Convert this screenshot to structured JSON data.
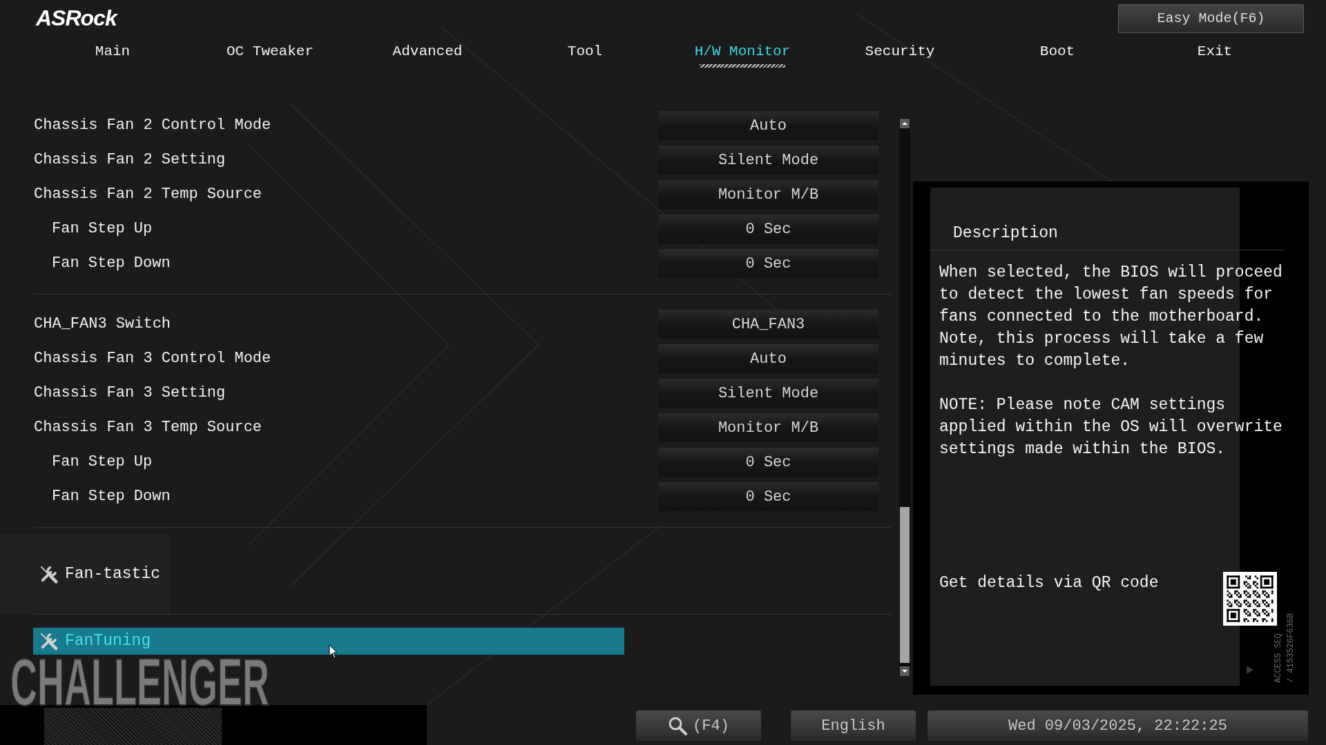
{
  "header": {
    "logo": "ASRock",
    "easy_mode_button": "Easy Mode(F6)"
  },
  "tabs": [
    {
      "label": "Main",
      "selected": false
    },
    {
      "label": "OC Tweaker",
      "selected": false
    },
    {
      "label": "Advanced",
      "selected": false
    },
    {
      "label": "Tool",
      "selected": false
    },
    {
      "label": "H/W Monitor",
      "selected": true
    },
    {
      "label": "Security",
      "selected": false
    },
    {
      "label": "Boot",
      "selected": false
    },
    {
      "label": "Exit",
      "selected": false
    }
  ],
  "groups": [
    {
      "items": [
        {
          "label": "Chassis Fan 2 Control Mode",
          "value": "Auto"
        },
        {
          "label": "Chassis Fan 2 Setting",
          "value": "Silent Mode"
        },
        {
          "label": "Chassis Fan 2 Temp Source",
          "value": "Monitor M/B",
          "children": [
            {
              "label": "Fan Step Up",
              "value": "0 Sec"
            },
            {
              "label": "Fan Step Down",
              "value": "0 Sec"
            }
          ]
        }
      ]
    },
    {
      "items": [
        {
          "label": "CHA_FAN3 Switch",
          "value": "CHA_FAN3"
        },
        {
          "label": "Chassis Fan 3 Control Mode",
          "value": "Auto"
        },
        {
          "label": "Chassis Fan 3 Setting",
          "value": "Silent Mode"
        },
        {
          "label": "Chassis Fan 3 Temp Source",
          "value": "Monitor M/B",
          "children": [
            {
              "label": "Fan Step Up",
              "value": "0 Sec"
            },
            {
              "label": "Fan Step Down",
              "value": "0 Sec"
            }
          ]
        }
      ]
    }
  ],
  "tools": [
    {
      "kind": "section",
      "label": "Fan-tastic",
      "selected": false
    },
    {
      "kind": "item",
      "label": "FanTuning",
      "selected": true
    }
  ],
  "brand_mark": "CHALLENGER",
  "description": {
    "title": "Description",
    "paragraphs": [
      "When selected, the BIOS will proceed to detect the lowest fan speeds for fans connected to the motherboard. Note, this process will take a few minutes to complete.",
      "NOTE: Please note CAM settings applied within the OS will overwrite settings made within the BIOS."
    ],
    "qr_caption": "Get details via QR code",
    "access_code": [
      "ACCESS SEQ",
      "/ 4153526F636B"
    ]
  },
  "bottom_bar": {
    "search_button": "(F4)",
    "language_button": "English",
    "datetime": "Wed 09/03/2025, 22:22:25"
  }
}
